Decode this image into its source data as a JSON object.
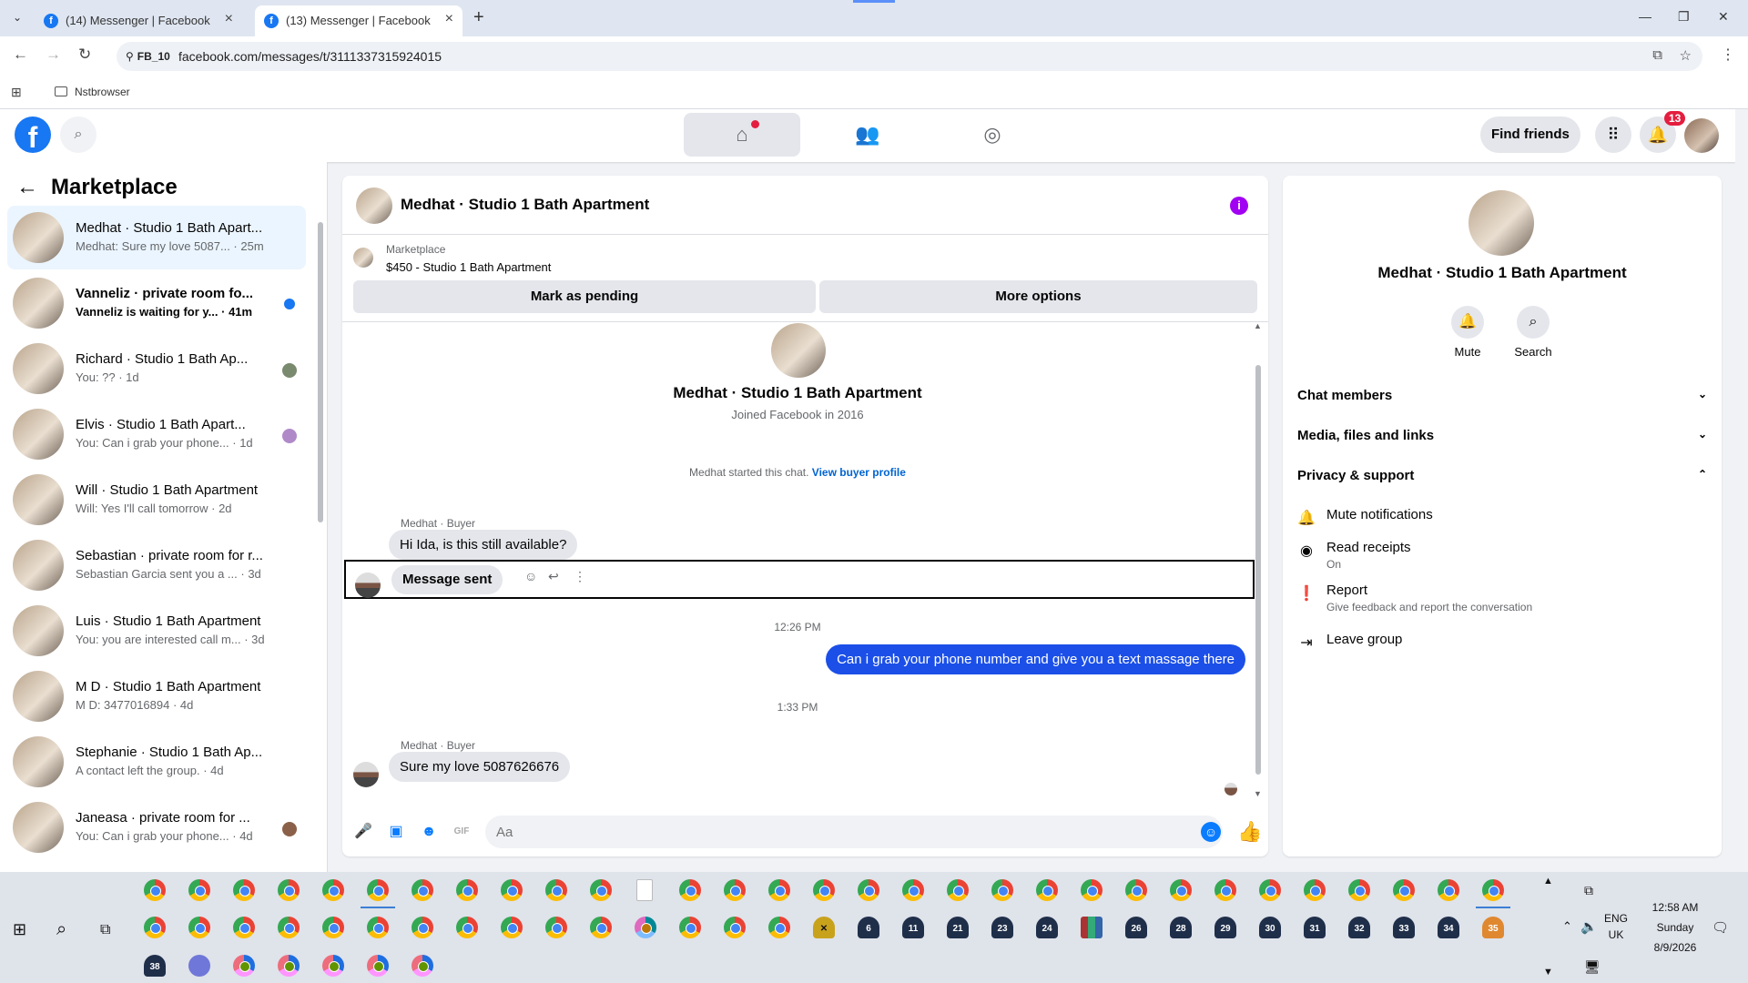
{
  "browser": {
    "tabs": [
      {
        "title": "(14) Messenger | Facebook"
      },
      {
        "title": "(13) Messenger | Facebook"
      }
    ],
    "site_chip": "FB_10",
    "url": "facebook.com/messages/t/3111337315924015",
    "bookmark": "Nstbrowser"
  },
  "fbnav": {
    "find_friends": "Find friends",
    "notification_count": "13"
  },
  "left": {
    "title": "Marketplace",
    "conversations": [
      {
        "name": "Medhat · Studio 1 Bath Apart...",
        "snippet": "Medhat: Sure my love 5087... · 25m"
      },
      {
        "name": "Vanneliz · private room fo...",
        "snippet": "Vanneliz is waiting for y... · 41m"
      },
      {
        "name": "Richard · Studio 1 Bath Ap...",
        "snippet": "You: ?? · 1d"
      },
      {
        "name": "Elvis · Studio 1 Bath Apart...",
        "snippet": "You: Can i grab your phone... · 1d"
      },
      {
        "name": "Will · Studio 1 Bath Apartment",
        "snippet": "Will: Yes I'll call tomorrow · 2d"
      },
      {
        "name": "Sebastian · private room for r...",
        "snippet": "Sebastian Garcia sent you a ... · 3d"
      },
      {
        "name": "Luis · Studio 1 Bath Apartment",
        "snippet": "You: you are interested call m... · 3d"
      },
      {
        "name": "M D · Studio 1 Bath Apartment",
        "snippet": "M D: 3477016894 · 4d"
      },
      {
        "name": "Stephanie · Studio 1 Bath Ap...",
        "snippet": "A contact left the group. · 4d"
      },
      {
        "name": "Janeasa · private room for ...",
        "snippet": "You: Can i grab your phone... · 4d"
      }
    ]
  },
  "chat": {
    "title": "Medhat · Studio 1 Bath Apartment",
    "marketplace_label": "Marketplace",
    "listing": "$450 - Studio 1 Bath Apartment",
    "mark_pending": "Mark as pending",
    "more_options": "More options",
    "hero_name": "Medhat · Studio 1 Bath Apartment",
    "hero_sub": "Joined Facebook in 2016",
    "started_text": "Medhat started this chat.",
    "view_buyer": "View buyer profile",
    "sender_label_1": "Medhat · Buyer",
    "msg_1": "Hi Ida, is this still available?",
    "message_sent": "Message sent",
    "time_1": "12:26 PM",
    "msg_out": "Can i grab your phone number and give  you a text massage there",
    "time_2": "1:33 PM",
    "sender_label_2": "Medhat · Buyer",
    "msg_2": "Sure my love  5087626676",
    "composer_placeholder": "Aa"
  },
  "right": {
    "name": "Medhat · Studio 1 Bath Apartment",
    "mute": "Mute",
    "search": "Search",
    "sections": {
      "chat_members": "Chat members",
      "media": "Media, files and links",
      "privacy": "Privacy & support"
    },
    "items": {
      "mute_notifications": "Mute notifications",
      "read_receipts": "Read receipts",
      "read_receipts_sub": "On",
      "report": "Report",
      "report_sub": "Give feedback and report the conversation",
      "leave_group": "Leave group"
    }
  },
  "taskbar": {
    "numbered_apps": [
      "6",
      "11",
      "21",
      "23",
      "24",
      "26",
      "28",
      "29",
      "30",
      "31",
      "32",
      "33",
      "34",
      "35"
    ],
    "extra_app": "38",
    "lang": "ENG",
    "region": "UK",
    "time": "12:58 AM",
    "day": "Sunday",
    "date": "8/9/2026"
  }
}
